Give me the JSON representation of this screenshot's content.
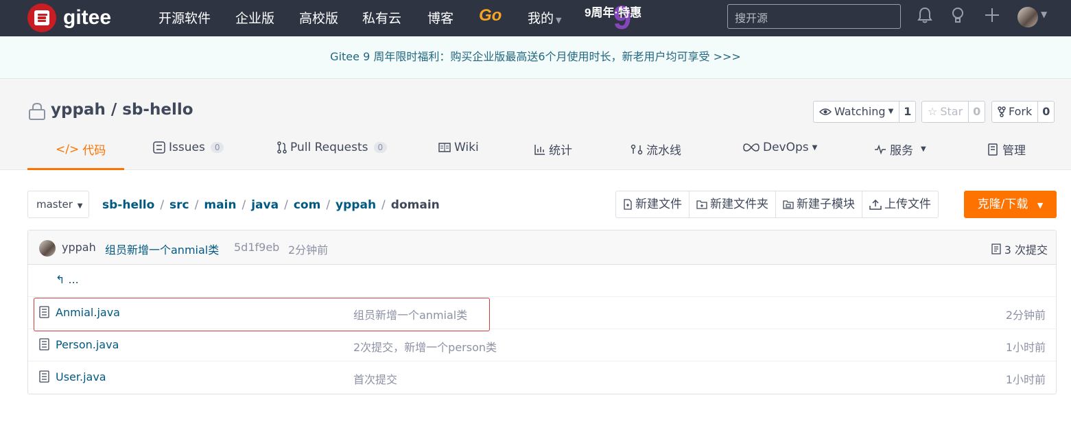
{
  "topnav": {
    "brand": "gitee",
    "links": [
      "开源软件",
      "企业版",
      "高校版",
      "私有云",
      "博客"
    ],
    "go": "Go",
    "mine": "我的",
    "promo": "9周年·特惠",
    "promo_number": "9",
    "search_placeholder": "搜开源",
    "icons": [
      "bell-icon",
      "lightbulb-icon",
      "plus-icon"
    ]
  },
  "banner": {
    "text": "Gitee 9 周年限时福利：购买企业版最高送6个月使用时长，新老用户均可享受 >>>"
  },
  "project": {
    "owner": "yppah",
    "slash": "/",
    "name": "sb-hello",
    "watch": {
      "label": "Watching",
      "count": "1"
    },
    "star": {
      "label": "Star",
      "count": "0"
    },
    "fork": {
      "label": "Fork",
      "count": "0"
    }
  },
  "tabs": {
    "code": "代码",
    "issues": "Issues",
    "issues_count": "0",
    "pulls": "Pull Requests",
    "pulls_count": "0",
    "wiki": "Wiki",
    "stats": "统计",
    "pipeline": "流水线",
    "devops": "DevOps",
    "service": "服务",
    "manage": "管理"
  },
  "toolbar": {
    "branch": "master",
    "path": [
      "sb-hello",
      "src",
      "main",
      "java",
      "com",
      "yppah"
    ],
    "path_current": "domain",
    "new_file": "新建文件",
    "new_folder": "新建文件夹",
    "new_submodule": "新建子模块",
    "upload": "上传文件",
    "clone": "克隆/下载"
  },
  "commit": {
    "author": "yppah",
    "message": "组员新增一个anmial类",
    "sha": "5d1f9eb",
    "time": "2分钟前",
    "count": "3 次提交"
  },
  "files": {
    "back": "...",
    "rows": [
      {
        "name": "Anmial.java",
        "message": "组员新增一个anmial类",
        "time": "2分钟前"
      },
      {
        "name": "Person.java",
        "message": "2次提交，新增一个person类",
        "time": "1小时前"
      },
      {
        "name": "User.java",
        "message": "首次提交",
        "time": "1小时前"
      }
    ]
  },
  "colors": {
    "accent": "#fe7300",
    "nav_bg": "#2e3442",
    "link": "#005980",
    "highlight": "#d23c3c"
  }
}
